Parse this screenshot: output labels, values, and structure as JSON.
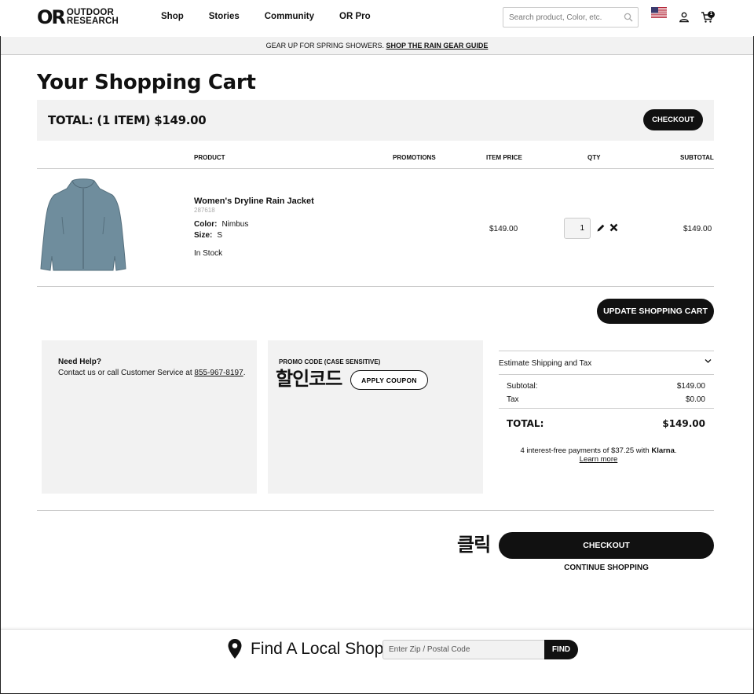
{
  "header": {
    "logo_mark": "OR",
    "logo_line1": "OUTDOOR",
    "logo_line2": "RESEARCH",
    "nav": [
      "Shop",
      "Stories",
      "Community",
      "OR Pro"
    ],
    "search_placeholder": "Search product, Color, etc.",
    "cart_count": "1"
  },
  "promo_bar": {
    "text": "GEAR UP FOR SPRING SHOWERS. ",
    "link": "SHOP THE RAIN GEAR GUIDE"
  },
  "page_title": "Your Shopping Cart",
  "total_bar": {
    "label": "TOTAL: (1 ITEM) $149.00",
    "checkout_label": "CHECKOUT"
  },
  "table": {
    "headers": [
      "PRODUCT",
      "PROMOTIONS",
      "ITEM PRICE",
      "QTY",
      "SUBTOTAL"
    ]
  },
  "item": {
    "name": "Women's Dryline Rain Jacket",
    "sku": "287618",
    "color_label": "Color:",
    "color_value": "Nimbus",
    "size_label": "Size:",
    "size_value": "S",
    "stock": "In Stock",
    "price": "$149.00",
    "qty": "1",
    "subtotal": "$149.00",
    "image_color": "#6f8d9d"
  },
  "update_cart_label": "UPDATE SHOPPING CART",
  "help": {
    "title": "Need Help?",
    "text": "Contact us or call Customer Service at ",
    "phone": "855-967-8197",
    "suffix": "."
  },
  "promo_code": {
    "title": "PROMO CODE (CASE SENSITIVE)",
    "annotation": "할인코드",
    "apply_label": "APPLY COUPON"
  },
  "summary": {
    "estimate_label": "Estimate Shipping and Tax",
    "subtotal_label": "Subtotal:",
    "subtotal_value": "$149.00",
    "tax_label": "Tax",
    "tax_value": "$0.00",
    "total_label": "TOTAL:",
    "total_value": "$149.00",
    "klarna_text": "4 interest-free payments of $37.25 with ",
    "klarna_brand": "Klarna",
    "klarna_suffix": ".",
    "learn_more": "Learn more"
  },
  "bottom": {
    "annotation": "클릭",
    "checkout_label": "CHECKOUT",
    "continue_label": "CONTINUE SHOPPING"
  },
  "footer": {
    "find_title": "Find A Local Shop",
    "zip_placeholder": "Enter Zip / Postal Code",
    "find_label": "FIND"
  }
}
